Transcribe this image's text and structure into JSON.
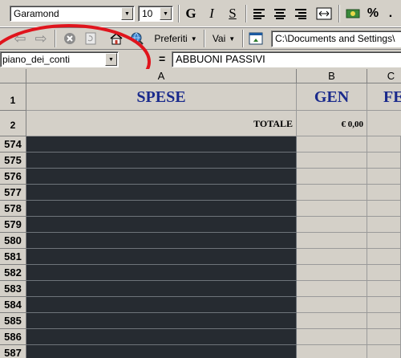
{
  "toolbar1": {
    "font_name": "Garamond",
    "font_size": "10",
    "bold": "G",
    "italic": "I",
    "underline": "S",
    "percent": "%",
    "thousands": "."
  },
  "toolbar2": {
    "favorites": "Preferiti",
    "go": "Vai",
    "address": "C:\\Documents and Settings\\"
  },
  "formula_bar": {
    "name_box": "piano_dei_conti",
    "equals": "=",
    "content": "ABBUONI PASSIVI"
  },
  "sheet": {
    "columns": [
      "A",
      "B",
      "C"
    ],
    "row1": {
      "num": "1",
      "a": "SPESE",
      "b": "GEN",
      "c": "FE"
    },
    "row2": {
      "num": "2",
      "a": "TOTALE",
      "b": "€ 0,00"
    },
    "rows": [
      "574",
      "575",
      "576",
      "577",
      "578",
      "579",
      "580",
      "581",
      "582",
      "583",
      "584",
      "585",
      "586",
      "587"
    ]
  },
  "colors": {
    "highlight_ellipse": "#e0141c",
    "title_blue": "#1a2a8c",
    "dark_fill": "#262b31"
  }
}
